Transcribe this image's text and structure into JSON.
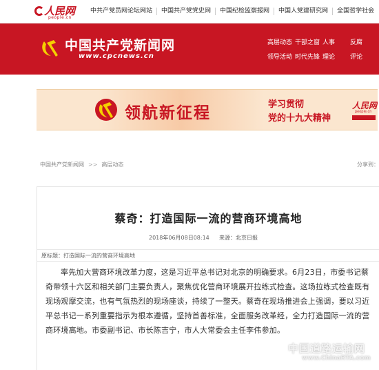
{
  "topbar": {
    "logo_text": "人民网",
    "logo_sub": "people.cn",
    "links": [
      "中共产党员网论坛网站",
      "中国共产党党史网",
      "中国纪检监察报网",
      "中国人党建研究网",
      "全国哲学社会"
    ]
  },
  "header": {
    "brand": "中国共产党新闻网",
    "url": "www.cpcnews.cn",
    "nav_row1": [
      "高层动态",
      "干部之窗",
      "人事",
      "反腐"
    ],
    "nav_row2": [
      "领导活动",
      "时代先锋",
      "理论",
      "评论"
    ]
  },
  "banner": {
    "title": "领航新征程",
    "sub1": "学习贯彻",
    "sub2": "党的十九大精神",
    "corner_logo": "人民网",
    "corner_sub": "people.cn"
  },
  "breadcrumb": {
    "home": "中国共产党新闻网",
    "sep": ">>",
    "section": "高层动态"
  },
  "share_label": "分享到：",
  "article": {
    "title": "蔡奇：打造国际一流的营商环境高地",
    "date": "2018年06月08日08:14",
    "source": "来源：北京日报",
    "origin": "原标题：打造国际一流的营商环境高地",
    "body": "率先加大营商环境改革力度，这是习近平总书记对北京的明确要求。6月23日，市委书记蔡奇带领十六区和相关部门主要负责人，聚焦优化营商环境展开拉练式检查。这场拉练式检查既有现场观摩交流，也有气氛热烈的现场座谈，持续了一整天。蔡奇在现场推进会上强调，要以习近平总书记一系列重要指示为根本遵循，坚持首善标准，全面服务改革经，全力打造国际一流的营商环境高地。市委副书记、市长陈吉宁，市人大常委会主任李伟参加。"
  },
  "watermark": {
    "line1": "中国道路运输网",
    "line2": "www.ChinaRTA.com"
  }
}
